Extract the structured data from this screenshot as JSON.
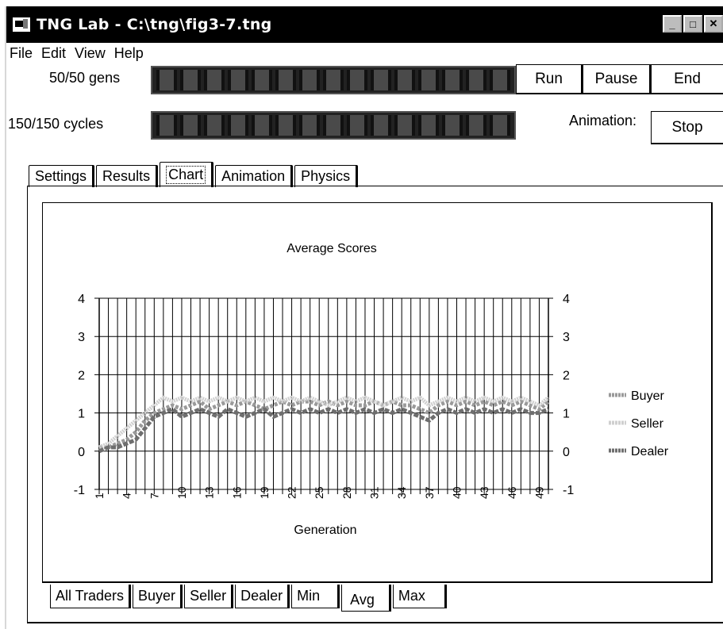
{
  "window": {
    "title": "TNG Lab - C:\\tng\\fig3-7.tng",
    "minimize_glyph": "_",
    "maximize_glyph": "□",
    "close_glyph": "✕"
  },
  "menu": [
    "File",
    "Edit",
    "View",
    "Help"
  ],
  "status": {
    "gens_label": "50/50 gens",
    "cycles_label": "150/150 cycles",
    "gens_progress": 1.0,
    "cycles_progress": 1.0,
    "animation_label": "Animation:"
  },
  "buttons": {
    "run": "Run",
    "pause": "Pause",
    "end": "End",
    "stop": "Stop"
  },
  "tabs": [
    "Settings",
    "Results",
    "Chart",
    "Animation",
    "Physics"
  ],
  "active_tab": "Chart",
  "bottom_tabs": [
    "All Traders",
    "Buyer",
    "Seller",
    "Dealer",
    "Min",
    "Avg",
    "Max"
  ],
  "active_bottom_tab": "Avg",
  "chart_data": {
    "type": "line",
    "title": "Average Scores",
    "xlabel": "Generation",
    "ylabel": "",
    "ylim": [
      -1,
      4
    ],
    "y_ticks": [
      "4",
      "3",
      "2",
      "1",
      "0",
      "-1"
    ],
    "x": [
      1,
      2,
      3,
      4,
      5,
      6,
      7,
      8,
      9,
      10,
      11,
      12,
      13,
      14,
      15,
      16,
      17,
      18,
      19,
      20,
      21,
      22,
      23,
      24,
      25,
      26,
      27,
      28,
      29,
      30,
      31,
      32,
      33,
      34,
      35,
      36,
      37,
      38,
      39,
      40,
      41,
      42,
      43,
      44,
      45,
      46,
      47,
      48,
      49,
      50
    ],
    "x_tick_labels": [
      "1",
      "4",
      "7",
      "10",
      "13",
      "16",
      "19",
      "22",
      "25",
      "28",
      "31",
      "34",
      "37",
      "40",
      "43",
      "46",
      "49"
    ],
    "grid": true,
    "legend": "right",
    "series": [
      {
        "name": "Buyer",
        "color": "#9a9a9a",
        "values": [
          0.1,
          0.1,
          0.2,
          0.3,
          0.5,
          0.8,
          1.0,
          1.1,
          1.2,
          1.1,
          1.2,
          1.3,
          1.1,
          1.2,
          1.3,
          1.2,
          1.3,
          1.2,
          1.1,
          1.2,
          1.3,
          1.2,
          1.3,
          1.3,
          1.2,
          1.3,
          1.2,
          1.3,
          1.2,
          1.2,
          1.3,
          1.2,
          1.3,
          1.2,
          1.2,
          1.1,
          1.0,
          1.2,
          1.3,
          1.2,
          1.3,
          1.2,
          1.3,
          1.2,
          1.3,
          1.2,
          1.3,
          1.2,
          1.1,
          1.3
        ]
      },
      {
        "name": "Seller",
        "color": "#cfcfcf",
        "values": [
          0.1,
          0.2,
          0.4,
          0.6,
          0.8,
          1.0,
          1.2,
          1.4,
          1.3,
          1.4,
          1.3,
          1.4,
          1.3,
          1.4,
          1.3,
          1.4,
          1.3,
          1.4,
          1.3,
          1.4,
          1.3,
          1.4,
          1.3,
          1.4,
          1.3,
          1.2,
          1.3,
          1.4,
          1.3,
          1.4,
          1.3,
          1.2,
          1.3,
          1.4,
          1.3,
          1.4,
          1.2,
          1.3,
          1.4,
          1.3,
          1.4,
          1.3,
          1.4,
          1.3,
          1.4,
          1.3,
          1.4,
          1.3,
          1.2,
          1.4
        ]
      },
      {
        "name": "Dealer",
        "color": "#6e6e6e",
        "values": [
          0.0,
          0.1,
          0.1,
          0.2,
          0.3,
          0.6,
          0.9,
          1.0,
          1.1,
          0.9,
          1.0,
          1.1,
          1.0,
          0.9,
          1.1,
          1.0,
          0.9,
          1.0,
          1.1,
          0.9,
          1.0,
          1.1,
          1.0,
          1.1,
          1.0,
          1.1,
          1.0,
          1.1,
          1.0,
          1.1,
          1.0,
          1.1,
          1.0,
          1.1,
          1.0,
          0.9,
          0.8,
          1.0,
          1.1,
          1.0,
          1.1,
          1.0,
          1.1,
          1.0,
          1.1,
          1.0,
          1.1,
          1.0,
          1.0,
          1.1
        ]
      }
    ]
  }
}
